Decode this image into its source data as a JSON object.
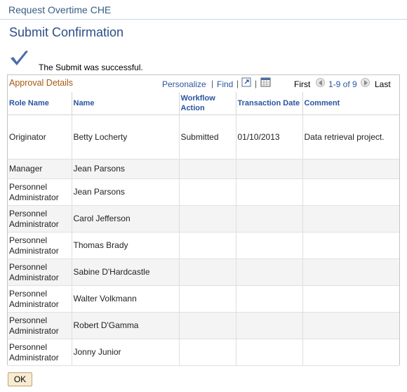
{
  "header": {
    "title": "Request Overtime CHE"
  },
  "page": {
    "title": "Submit Confirmation",
    "success_message": "The Submit was successful."
  },
  "grid": {
    "title": "Approval Details",
    "toolbar": {
      "personalize": "Personalize",
      "separator": "|",
      "find": "Find",
      "first": "First",
      "range": "1-9 of 9",
      "last": "Last"
    },
    "columns": [
      "Role Name",
      "Name",
      "Workflow Action",
      "Transaction Date",
      "Comment"
    ],
    "rows": [
      [
        "Originator",
        "Betty Locherty",
        "Submitted",
        "01/10/2013",
        "Data retrieval project."
      ],
      [
        "Manager",
        "Jean Parsons",
        "",
        "",
        ""
      ],
      [
        "Personnel Administrator",
        "Jean Parsons",
        "",
        "",
        ""
      ],
      [
        "Personnel Administrator",
        "Carol Jefferson",
        "",
        "",
        ""
      ],
      [
        "Personnel Administrator",
        "Thomas Brady",
        "",
        "",
        ""
      ],
      [
        "Personnel Administrator",
        "Sabine D'Hardcastle",
        "",
        "",
        ""
      ],
      [
        "Personnel Administrator",
        "Walter Volkmann",
        "",
        "",
        ""
      ],
      [
        "Personnel Administrator",
        "Robert D'Gamma",
        "",
        "",
        ""
      ],
      [
        "Personnel Administrator",
        "Jonny Junior",
        "",
        "",
        ""
      ]
    ]
  },
  "actions": {
    "ok_label": "OK"
  },
  "icons": {
    "check": "checkmark-icon",
    "zoom": "zoom-window-icon",
    "download": "download-spreadsheet-icon",
    "prev": "previous-arrow-icon",
    "next": "next-arrow-icon"
  },
  "colors": {
    "title": "#2c4e86",
    "grid_title": "#a6570e",
    "link": "#2a55a0",
    "row_alt": "#f4f4f4"
  }
}
